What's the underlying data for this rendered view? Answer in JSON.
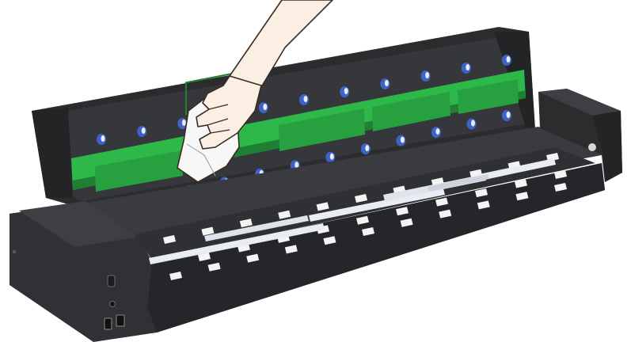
{
  "illustration": {
    "subject": "scanner-maintenance",
    "colors": {
      "background": "#ffffff",
      "body_dark": "#2b2c2e",
      "body_mid": "#3a3b3e",
      "body_light": "#505255",
      "glass_green": "#2fb84a",
      "glass_green_dark": "#1f7f33",
      "roller_blue": "#3d63c9",
      "roller_white": "#e9ecf2",
      "pad_white": "#f4f4f4",
      "skin": "#fbeee2",
      "skin_outline": "#3a2a20",
      "cloth": "#f7f7f7"
    },
    "icons": {
      "power_switch": "power-switch-icon",
      "lock_slot": "lock-icon",
      "usb_port": "usb-icon",
      "lan_port": "lan-icon"
    }
  }
}
